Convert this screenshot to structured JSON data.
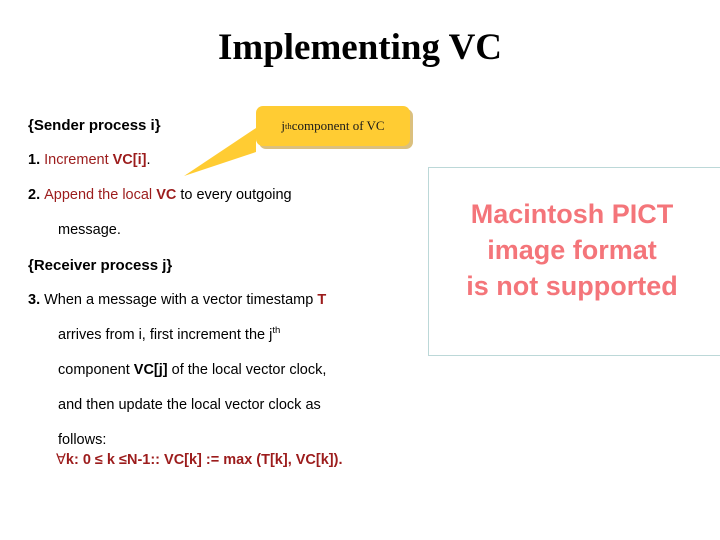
{
  "slide": {
    "title": "Implementing VC"
  },
  "callout": {
    "text_prefix": "j",
    "text_sup": "th",
    "text_suffix": " component of VC",
    "fill_color": "#FFCC33",
    "shadow_color": "#BE8C14"
  },
  "colors": {
    "accent_red": "#9C1C1C",
    "pict_text": "#F4757A",
    "pict_border": "#BCD8D8",
    "text": "#000000"
  },
  "body": {
    "sender_header": "{Sender process i}",
    "step1": {
      "number": "1.",
      "red_text": "Increment ",
      "red_bold": "VC[i]",
      "black_tail": "."
    },
    "step2": {
      "number": "2.",
      "red_text": "Append the local ",
      "red_bold": "VC",
      "black_tail": " to every outgoing",
      "continuation": "message."
    },
    "receiver_header": "{Receiver process j}",
    "step3": {
      "number": "3.",
      "lead": " When a message with a vector timestamp ",
      "timestamp_symbol": "T",
      "line2_a": "arrives  from  i,  first  increment  the  j",
      "line2_sup": "th",
      "line3_a": "component ",
      "line3_bold": "VC[j]",
      "line3_b": " of the local vector clock,",
      "line4": "and  then  update  the  local  vector  clock  as",
      "line5": "follows:"
    },
    "formula": {
      "quantifier": "∀",
      "text": "k: 0 ≤ k ≤N-1:: VC[k] := max (T[k], VC[k])."
    }
  },
  "pict_placeholder": {
    "line1": "Macintosh PICT",
    "line2": "image format",
    "line3": "is not supported"
  }
}
